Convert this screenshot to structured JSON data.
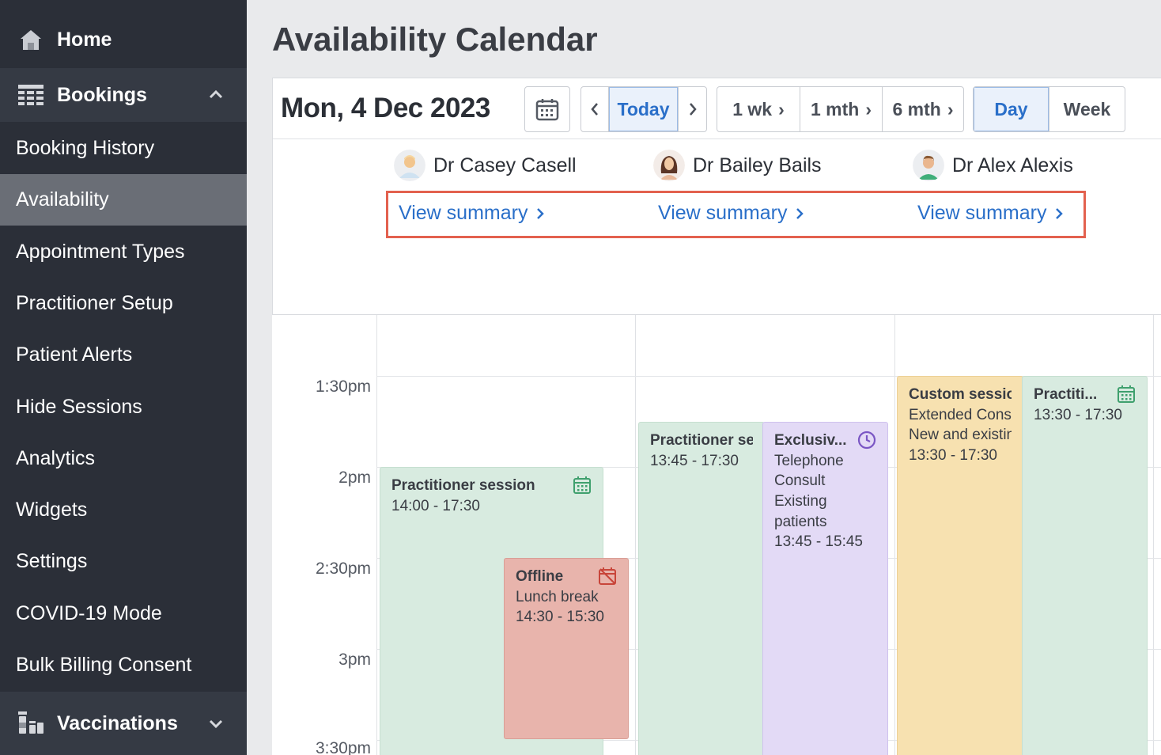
{
  "sidebar": {
    "home": "Home",
    "bookings": "Bookings",
    "items": [
      "Booking History",
      "Availability",
      "Appointment Types",
      "Practitioner Setup",
      "Patient Alerts",
      "Hide Sessions",
      "Analytics",
      "Widgets",
      "Settings",
      "COVID-19 Mode",
      "Bulk Billing Consent"
    ],
    "active_item": "Availability",
    "vaccinations": "Vaccinations"
  },
  "page": {
    "title": "Availability Calendar"
  },
  "toolbar": {
    "date": "Mon, 4 Dec 2023",
    "today": "Today",
    "ranges": [
      "1 wk",
      "1 mth",
      "6 mth"
    ],
    "views": [
      "Day",
      "Week"
    ],
    "selected_view": "Day"
  },
  "practitioners": [
    {
      "name": "Dr Casey Casell",
      "summary": "View summary"
    },
    {
      "name": "Dr Bailey Bails",
      "summary": "View summary"
    },
    {
      "name": "Dr Alex Alexis",
      "summary": "View summary"
    }
  ],
  "times": [
    "1:30pm",
    "2pm",
    "2:30pm",
    "3pm",
    "3:30pm"
  ],
  "events": [
    {
      "title": "Practitioner session",
      "lines": [
        "14:00 - 17:30"
      ],
      "icon": "calendar-icon",
      "color": "#d8ebe0"
    },
    {
      "title": "Offline",
      "lines": [
        "Lunch break",
        "14:30 - 15:30"
      ],
      "icon": "calendar-off-icon",
      "color": "#e8b4ac"
    },
    {
      "title": "Practitioner sess",
      "lines": [
        "13:45 - 17:30"
      ],
      "color": "#d8ebe0"
    },
    {
      "title": "Exclusiv...",
      "lines": [
        "Telephone",
        "Consult",
        "Existing",
        "patients",
        "13:45 - 15:45"
      ],
      "icon": "clock-icon",
      "color": "#e3daf6"
    },
    {
      "title": "Custom session",
      "lines": [
        "Extended Consul",
        "New and existing",
        "13:30 - 17:30"
      ],
      "color": "#f7e1b0"
    },
    {
      "title": "Practiti...",
      "lines": [
        "13:30 - 17:30"
      ],
      "icon": "calendar-icon",
      "color": "#d8ebe0"
    }
  ],
  "colors": {
    "accent": "#2a6fc9",
    "highlight": "#e3614f",
    "sidebar": "#2b2f38"
  }
}
